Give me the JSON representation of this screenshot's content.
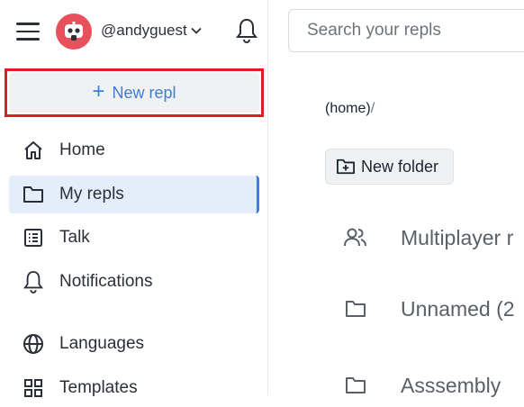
{
  "header": {
    "username": "@andyguest",
    "menu_icon": "hamburger-icon",
    "notification_icon": "bell-icon",
    "colors": {
      "avatar_bg": "#e8505b"
    }
  },
  "sidebar": {
    "new_repl_label": "New repl",
    "items": [
      {
        "label": "Home",
        "icon": "home-icon"
      },
      {
        "label": "My repls",
        "icon": "folder-icon",
        "active": true
      },
      {
        "label": "Talk",
        "icon": "list-icon"
      },
      {
        "label": "Notifications",
        "icon": "bell-icon"
      },
      {
        "label": "Languages",
        "icon": "globe-icon"
      },
      {
        "label": "Templates",
        "icon": "grid-icon"
      }
    ],
    "colors": {
      "accent": "#3d7ddb",
      "highlight_border": "#e01b24",
      "active_bg": "#e4eefb"
    }
  },
  "main": {
    "search_placeholder": "Search your repls",
    "breadcrumb": {
      "root": "(home)",
      "separator": "/"
    },
    "new_folder_label": "New folder",
    "entries": [
      {
        "name": "Multiplayer r",
        "icon": "users-icon"
      },
      {
        "name": "Unnamed (2",
        "icon": "folder-icon"
      },
      {
        "name": "Asssembly",
        "icon": "folder-icon"
      }
    ]
  }
}
